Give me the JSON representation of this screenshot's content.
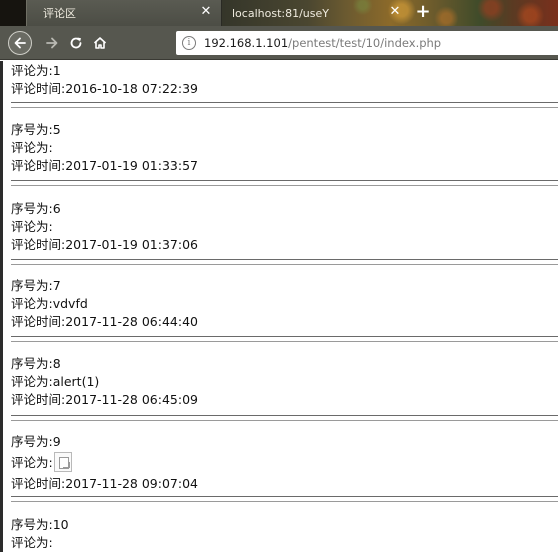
{
  "browser": {
    "tabs": [
      {
        "label": "评论区",
        "close": "✕"
      },
      {
        "label": "localhost:81/useY",
        "close": "✕"
      }
    ],
    "new_tab": "+",
    "url": {
      "host": "192.168.1.101",
      "path": "/pentest/test/10/index.php"
    }
  },
  "labels": {
    "seq": "序号为:",
    "comment": "评论为:",
    "time": "评论时间:"
  },
  "comments": [
    {
      "seq": "",
      "comment": "1",
      "time": "2016-10-18 07:22:39"
    },
    {
      "seq": "5",
      "comment": "",
      "time": "2017-01-19 01:33:57"
    },
    {
      "seq": "6",
      "comment": "",
      "time": "2017-01-19 01:37:06"
    },
    {
      "seq": "7",
      "comment": "vdvfd",
      "time": "2017-11-28 06:44:40"
    },
    {
      "seq": "8",
      "comment": "alert(1)",
      "time": "2017-11-28 06:45:09"
    },
    {
      "seq": "9",
      "comment": "",
      "time": "2017-11-28 09:07:04",
      "comment_is_image": true
    },
    {
      "seq": "10",
      "comment": "",
      "time": ""
    }
  ]
}
